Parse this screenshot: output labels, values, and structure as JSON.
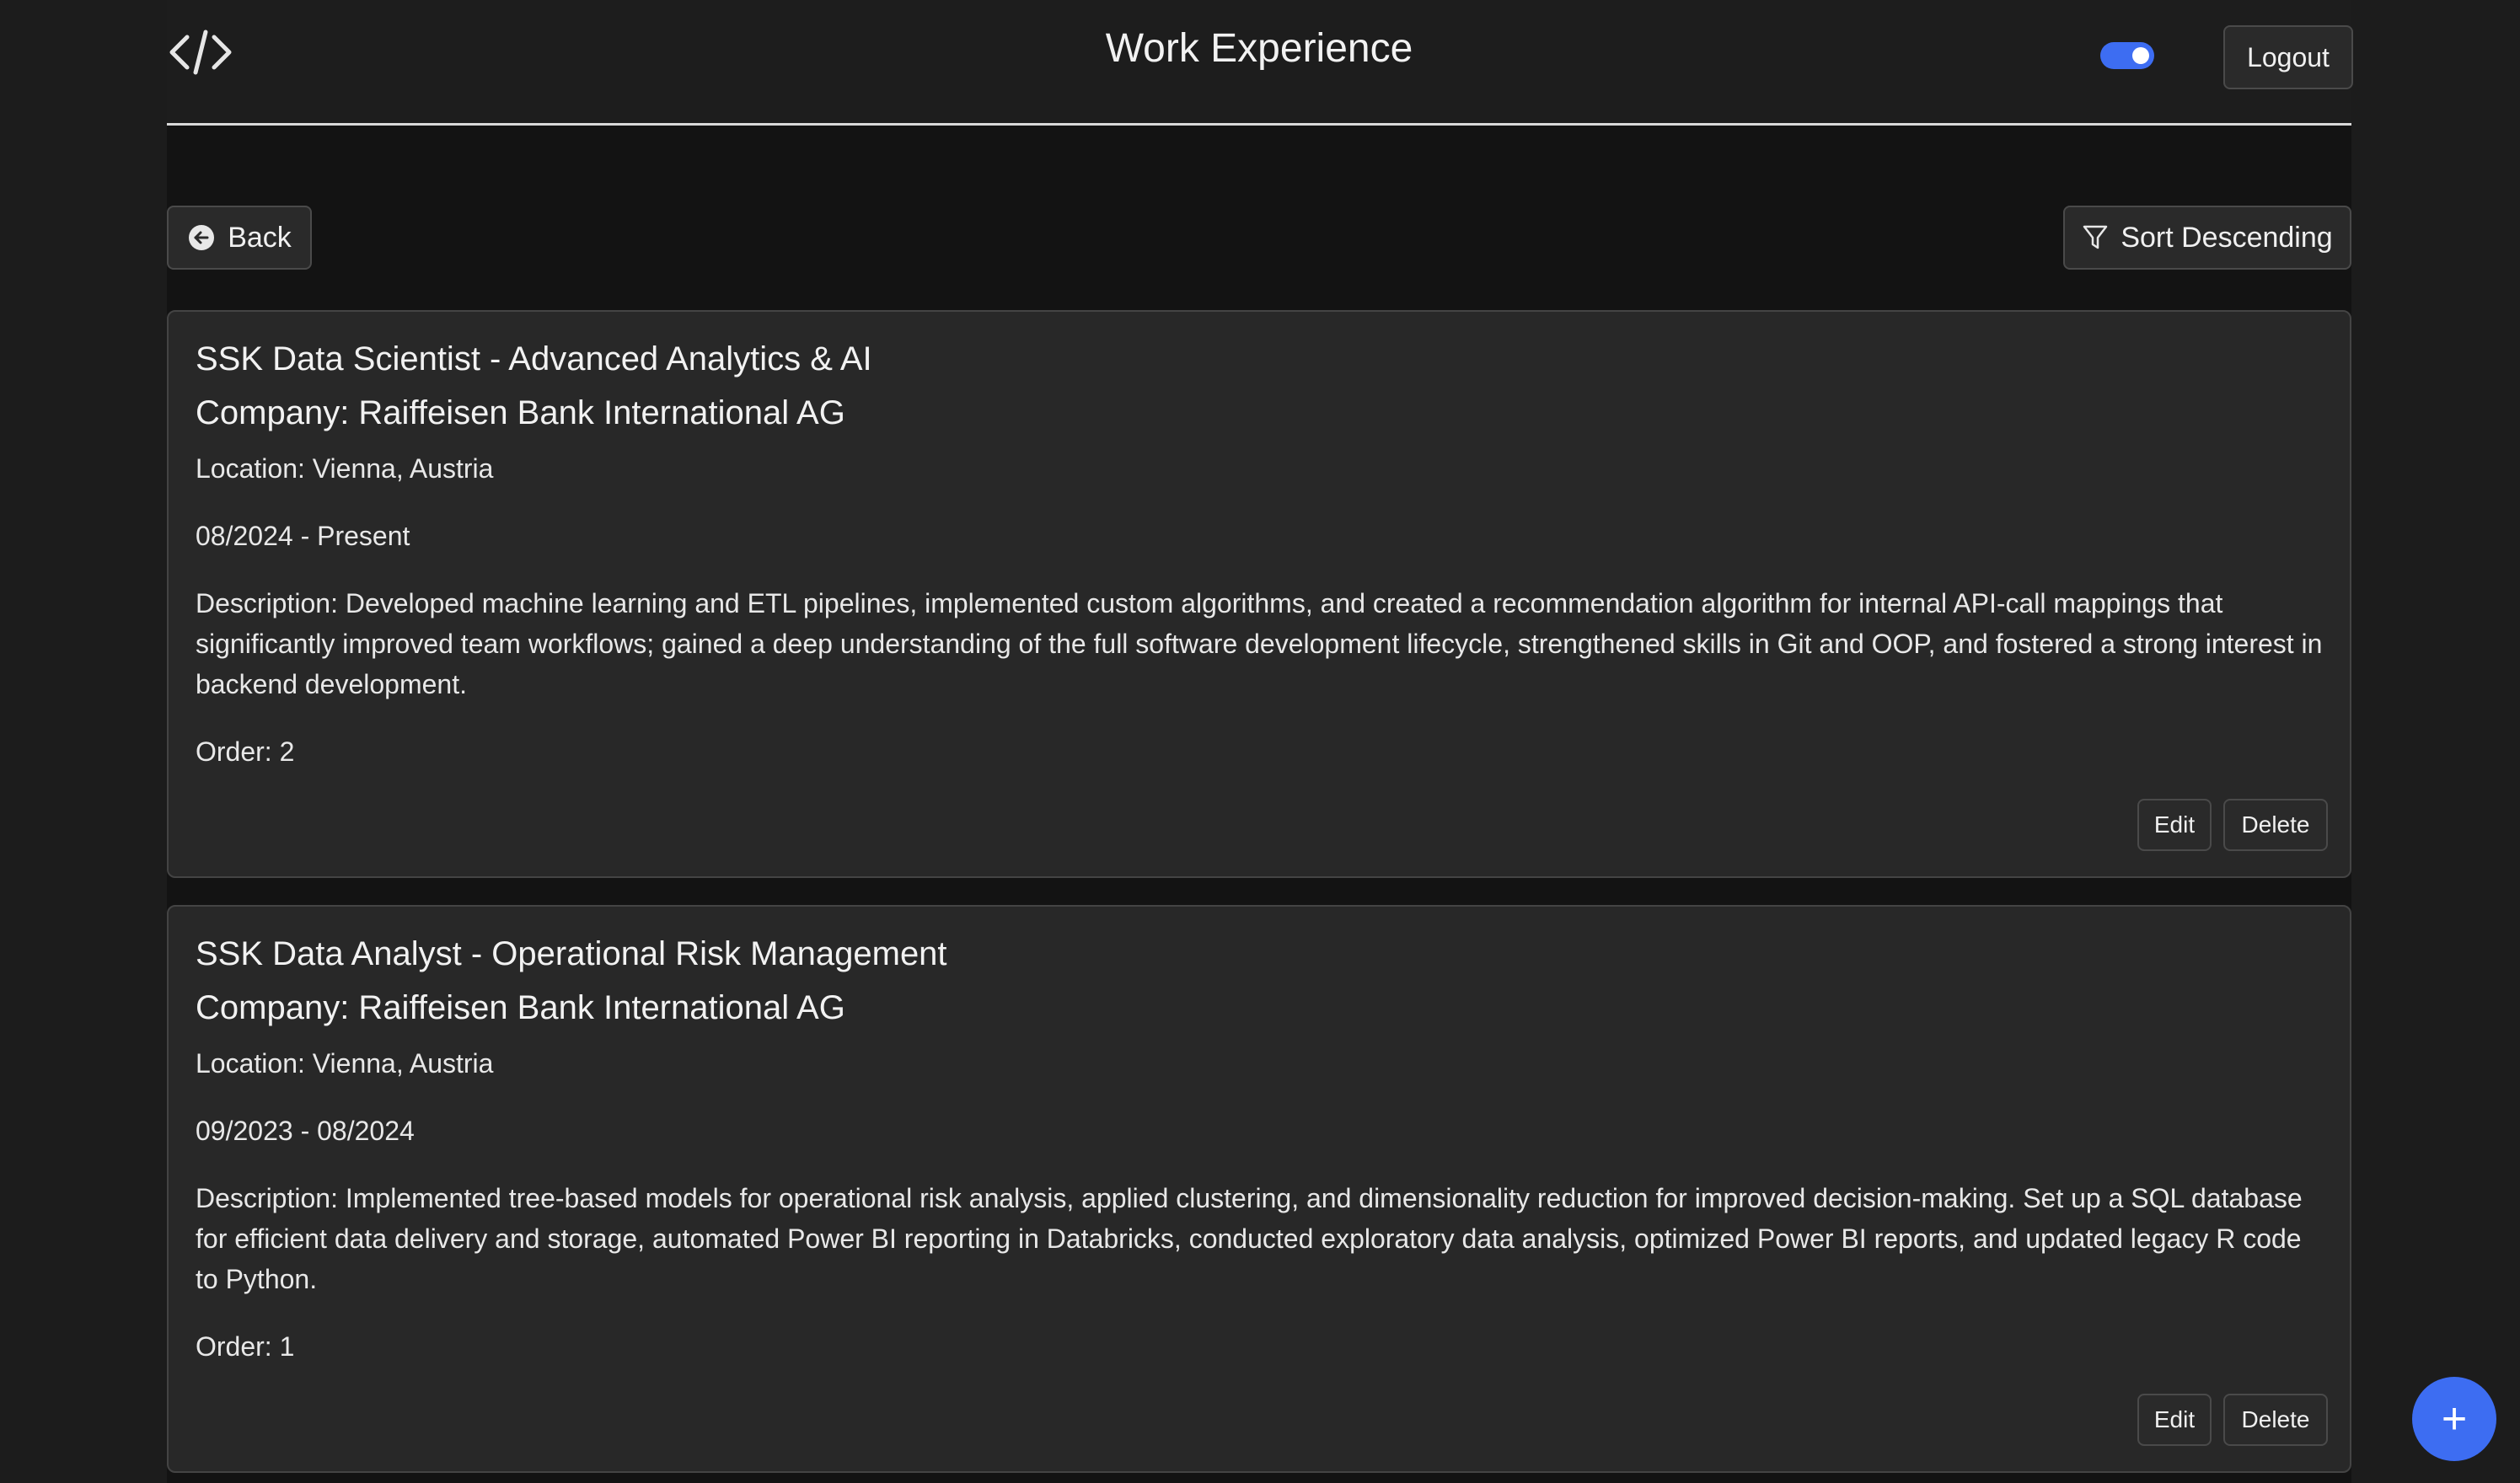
{
  "header": {
    "logo_icon": "code-brackets-icon",
    "title": "Work Experience",
    "theme_toggle": {
      "state": "on",
      "color": "#3d6df2"
    },
    "logout_label": "Logout"
  },
  "toolbar": {
    "back_label": "Back",
    "back_icon": "arrow-left-circle-icon",
    "sort_label": "Sort Descending",
    "sort_icon": "filter-funnel-icon"
  },
  "entries": [
    {
      "title": "SSK Data Scientist - Advanced Analytics & AI",
      "company": "Company: Raiffeisen Bank International AG",
      "location": "Location: Vienna, Austria",
      "dates": "08/2024 - Present",
      "description": "Description: Developed machine learning and ETL pipelines, implemented custom algorithms, and created a recommendation algorithm for internal API-call mappings that significantly improved team workflows; gained a deep understanding of the full software development lifecycle, strengthened skills in Git and OOP, and fostered a strong interest in backend development.",
      "order": "Order: 2",
      "edit_label": "Edit",
      "delete_label": "Delete"
    },
    {
      "title": "SSK Data Analyst - Operational Risk Management",
      "company": "Company: Raiffeisen Bank International AG",
      "location": "Location: Vienna, Austria",
      "dates": "09/2023 - 08/2024",
      "description": "Description: Implemented tree-based models for operational risk analysis, applied clustering, and dimensionality reduction for improved decision-making. Set up a SQL database for efficient data delivery and storage, automated Power BI reporting in Databricks, conducted exploratory data analysis, optimized Power BI reports, and updated legacy R code to Python.",
      "order": "Order: 1",
      "edit_label": "Edit",
      "delete_label": "Delete"
    }
  ],
  "fab": {
    "label": "+",
    "icon": "plus-icon",
    "color": "#3d6df2"
  }
}
